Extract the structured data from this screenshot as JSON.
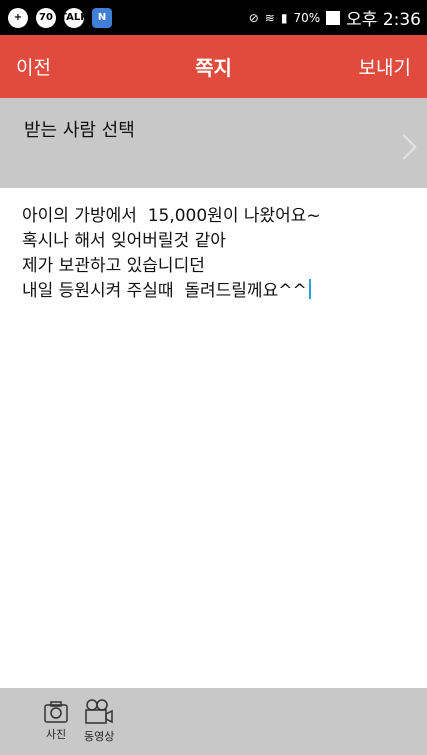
{
  "statusbar": {
    "icons": [
      "app-icon",
      "70",
      "TALK",
      "N"
    ],
    "battery": "70%",
    "time": "오후 2:36"
  },
  "header": {
    "back": "이전",
    "title": "쪽지",
    "send": "보내기"
  },
  "recipient": {
    "label": "받는 사람 선택"
  },
  "message": {
    "lines": [
      "아이의 가방에서  15,000원이 나왔어요~",
      "혹시나 해서 잊어버릴것 같아",
      "제가 보관하고 있습니디던",
      "내일 등원시켜 주실때  돌려드릴께요^^"
    ]
  },
  "bottombar": {
    "photo_label": "사진",
    "video_label": "동영상"
  },
  "colors": {
    "header": "#e04b3d",
    "panel": "#c8c8c8",
    "caret": "#2aa0d8"
  }
}
